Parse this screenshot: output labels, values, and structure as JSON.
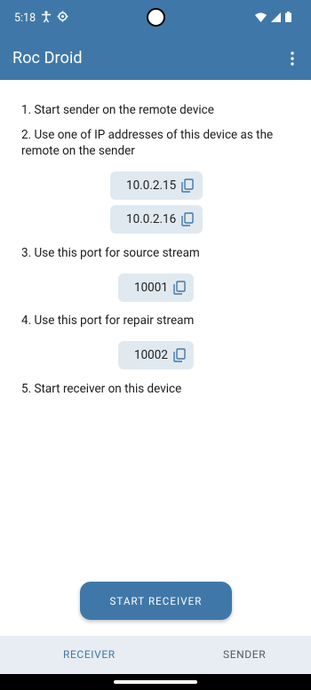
{
  "status_bar": {
    "time": "5:18"
  },
  "app_bar": {
    "title": "Roc Droid"
  },
  "steps": {
    "step1": "1. Start sender on the remote device",
    "step2": "2. Use one of IP addresses of this device as the remote on the sender",
    "step3": "3. Use this port for source stream",
    "step4": "4. Use this port for repair stream",
    "step5": "5. Start receiver on this device"
  },
  "addresses": [
    "10.0.2.15",
    "10.0.2.16"
  ],
  "ports": {
    "source": "10001",
    "repair": "10002"
  },
  "actions": {
    "start_receiver": "START RECEIVER"
  },
  "bottom_nav": {
    "receiver": "RECEIVER",
    "sender": "SENDER"
  },
  "colors": {
    "primary": "#3f78a8",
    "chip_background": "#e1e9f0",
    "bottom_nav_background": "#e7edf2"
  }
}
